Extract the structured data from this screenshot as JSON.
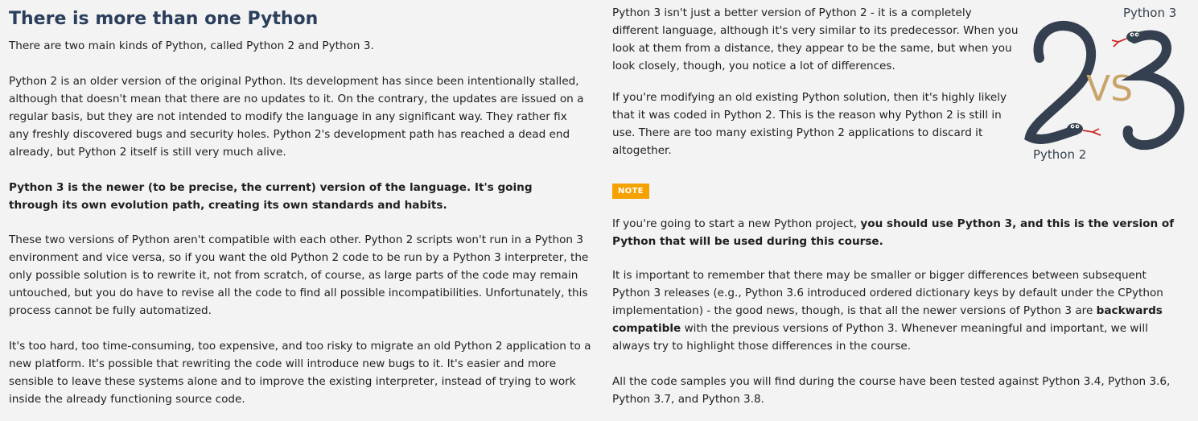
{
  "left": {
    "title": "There is more than one Python",
    "p1": "There are two main kinds of Python, called Python 2 and Python 3.",
    "p2": "Python 2 is an older version of the original Python. Its development has since been intentionally stalled, although that doesn't mean that there are no updates to it. On the contrary, the updates are issued on a regular basis, but they are not intended to modify the language in any significant way. They rather fix any freshly discovered bugs and security holes. Python 2's development path has reached a dead end already, but Python 2 itself is still very much alive.",
    "p3": "Python 3 is the newer (to be precise, the current) version of the language. It's going through its own evolution path, creating its own standards and habits.",
    "p4": "These two versions of Python aren't compatible with each other. Python 2 scripts won't run in a Python 3 environment and vice versa, so if you want the old Python 2 code to be run by a Python 3 interpreter, the only possible solution is to rewrite it, not from scratch, of course, as large parts of the code may remain untouched, but you do have to revise all the code to find all possible incompatibilities. Unfortunately, this process cannot be fully automatized.",
    "p5": "It's too hard, too time-consuming, too expensive, and too risky to migrate an old Python 2 application to a new platform. It's possible that rewriting the code will introduce new bugs to it. It's easier and more sensible to leave these systems alone and to improve the existing interpreter, instead of trying to work inside the already functioning source code."
  },
  "right": {
    "p1": "Python 3 isn't just a better version of Python 2 - it is a completely different language, although it's very similar to its predecessor. When you look at them from a distance, they appear to be the same, but when you look closely, though, you notice a lot of differences.",
    "p2": "If you're modifying an old existing Python solution, then it's highly likely that it was coded in Python 2. This is the reason why Python 2 is still in use. There are too many existing Python 2 applications to discard it altogether.",
    "note_label": "NOTE",
    "p3_lead": "If you're going to start a new Python project,",
    "p3_bold": "you should use Python 3, and this is the version of Python that will be used during this course.",
    "p4_a": "It is important to remember that there may be smaller or bigger differences between subsequent Python 3 releases (e.g., Python 3.6 introduced ordered dictionary keys by default under the CPython implementation) - the good news, though, is that all the newer versions of Python 3 are",
    "p4_bold": "backwards compatible",
    "p4_b": "with the previous versions of Python 3. Whenever meaningful and important, we will always try to highlight those differences in the course.",
    "p5": "All the code samples you will find during the course have been tested against Python 3.4, Python 3.6, Python 3.7, and Python 3.8."
  },
  "logo": {
    "label_top": "Python 3",
    "label_vs": "VS",
    "label_bottom": "Python 2",
    "colors": {
      "snake": "#34404f",
      "vs": "#c9a46a",
      "tongue": "#cc2a2a"
    }
  }
}
